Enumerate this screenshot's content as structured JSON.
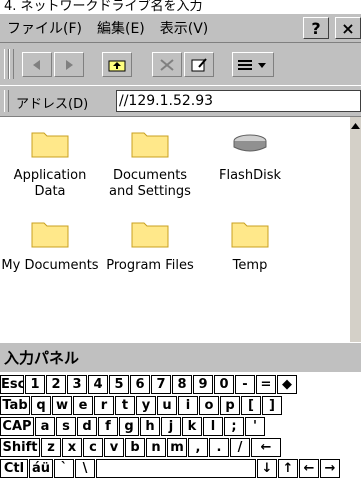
{
  "caption": "4. ネットワークドライブ名を入力",
  "menu": {
    "file": "ファイル(F)",
    "edit": "編集(E)",
    "view": "表示(V)",
    "help_btn": "?",
    "close_btn": "×"
  },
  "address": {
    "label": "アドレス(D)",
    "value": "//129.1.52.93"
  },
  "files": [
    {
      "name": "Application Data",
      "icon": "folder-icon"
    },
    {
      "name": "Documents and Settings",
      "icon": "folder-icon"
    },
    {
      "name": "FlashDisk",
      "icon": "disk-icon"
    },
    {
      "name": "My Documents",
      "icon": "folder-icon"
    },
    {
      "name": "Program Files",
      "icon": "folder-icon"
    },
    {
      "name": "Temp",
      "icon": "folder-icon"
    }
  ],
  "panel": {
    "title": "入力パネル"
  },
  "keyboard": {
    "row1": [
      "Esc",
      "1",
      "2",
      "3",
      "4",
      "5",
      "6",
      "7",
      "8",
      "9",
      "0",
      "-",
      "=",
      "◆"
    ],
    "row2": [
      "Tab",
      "q",
      "w",
      "e",
      "r",
      "t",
      "y",
      "u",
      "i",
      "o",
      "p",
      "[",
      "]"
    ],
    "row3": [
      "CAP",
      "a",
      "s",
      "d",
      "f",
      "g",
      "h",
      "j",
      "k",
      "l",
      ";",
      "'"
    ],
    "row4": [
      "Shift",
      "z",
      "x",
      "c",
      "v",
      "b",
      "n",
      "m",
      ",",
      ".",
      "/",
      "←"
    ],
    "row5": [
      "Ctl",
      "áü",
      "`",
      "\\",
      "",
      "↓",
      "↑",
      "←",
      "→"
    ]
  }
}
